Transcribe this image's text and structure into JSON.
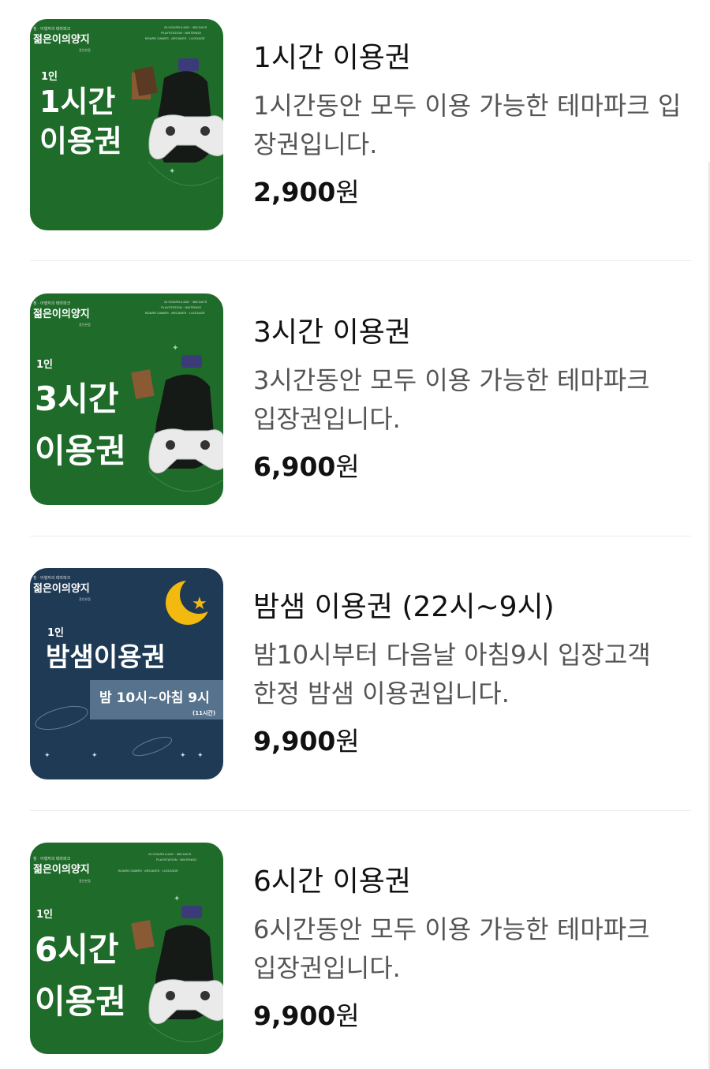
{
  "products": [
    {
      "title": "1시간 이용권",
      "desc_line1": "1시간동안 모두 이용 가능한 테마파크 입",
      "desc_line2": "장권입니다.",
      "price": "2,900",
      "currency": "원",
      "thumb": {
        "theme": "green",
        "tagline": "젊은이의양지",
        "people": "1인",
        "line1": "1시간",
        "line2": "이용권"
      }
    },
    {
      "title": "3시간 이용권",
      "desc_line1": "3시간동안 모두 이용 가능한 테마파크",
      "desc_line2": "입장권입니다.",
      "price": "6,900",
      "currency": "원",
      "thumb": {
        "theme": "green",
        "tagline": "젊은이의양지",
        "people": "1인",
        "line1": "3시간",
        "line2": "이용권"
      }
    },
    {
      "title": "밤샘 이용권 (22시~9시)",
      "desc_line1": "밤10시부터 다음날 아침9시 입장고객",
      "desc_line2": "한정 밤샘 이용권입니다.",
      "price": "9,900",
      "currency": "원",
      "thumb": {
        "theme": "navy",
        "tagline": "젊은이의양지",
        "people": "1인",
        "line1": "밤샘이용권",
        "banner": "밤 10시~아침 9시",
        "sub": "(11시간)"
      }
    },
    {
      "title": "6시간 이용권",
      "desc_line1": "6시간동안 모두 이용 가능한 테마파크",
      "desc_line2": "입장권입니다.",
      "price": "9,900",
      "currency": "원",
      "thumb": {
        "theme": "green",
        "tagline": "젊은이의양지",
        "people": "1인",
        "line1": "6시간",
        "line2": "이용권"
      }
    }
  ],
  "colors": {
    "green": "#1f6b2a",
    "navy": "#1f3a55",
    "moon": "#f2b90f"
  }
}
